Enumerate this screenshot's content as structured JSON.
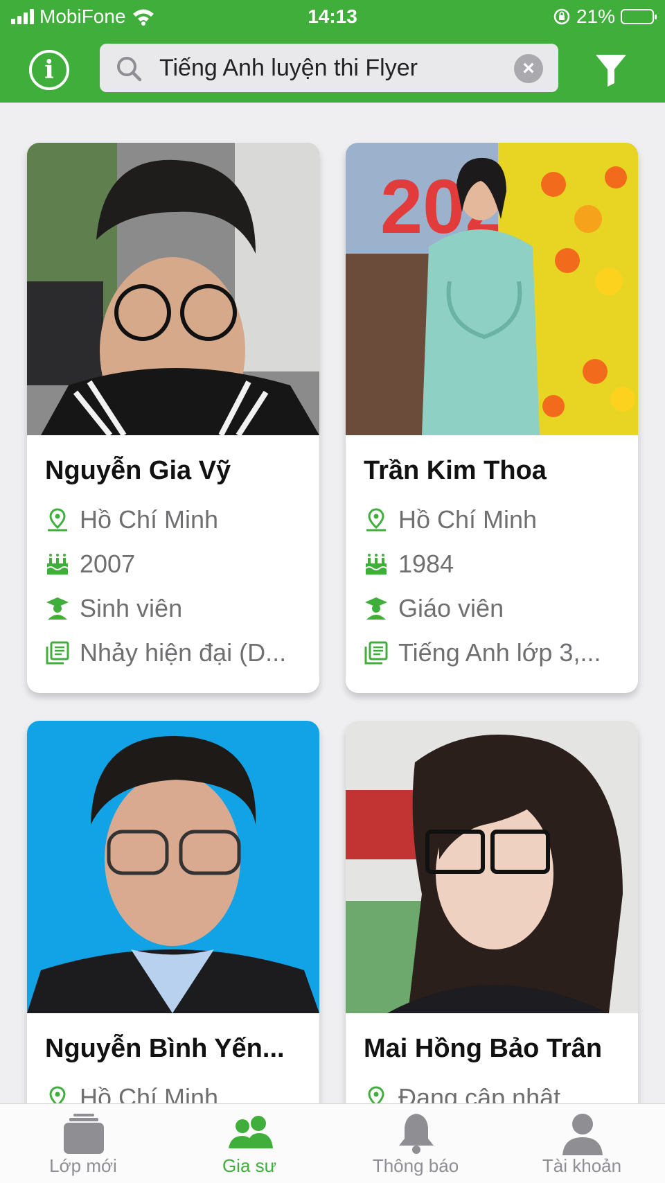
{
  "status_bar": {
    "carrier": "MobiFone",
    "time": "14:13",
    "battery": "21%",
    "battery_level": 0.21
  },
  "header": {
    "search_query": "Tiếng Anh luyện thi Flyer"
  },
  "colors": {
    "brand": "#3fae3b",
    "text_muted": "#6f6f72",
    "battery": "#ffd60a"
  },
  "icons": {
    "info": "info-icon",
    "search": "search-icon",
    "clear": "clear-icon",
    "filter": "filter-icon",
    "location": "location-pin-icon",
    "birthday": "cake-icon",
    "occupation": "graduate-icon",
    "subjects": "book-list-icon"
  },
  "tutors": [
    {
      "name": "Nguyễn Gia Vỹ",
      "location": "Hồ Chí Minh",
      "birth_year": "2007",
      "occupation": "Sinh viên",
      "subjects": "Nhảy hiện đại (D..."
    },
    {
      "name": "Trần Kim Thoa",
      "location": "Hồ Chí Minh",
      "birth_year": "1984",
      "occupation": "Giáo viên",
      "subjects": "Tiếng Anh lớp 3,..."
    },
    {
      "name": "Nguyễn Bình Yến...",
      "location": "Hồ Chí Minh"
    },
    {
      "name": "Mai Hồng Bảo Trân",
      "location": "Đang cập nhật"
    }
  ],
  "tabs": [
    {
      "label": "Lớp mới",
      "icon": "classes-icon",
      "active": false
    },
    {
      "label": "Gia sư",
      "icon": "tutors-icon",
      "active": true
    },
    {
      "label": "Thông báo",
      "icon": "bell-icon",
      "active": false
    },
    {
      "label": "Tài khoản",
      "icon": "account-icon",
      "active": false
    }
  ]
}
